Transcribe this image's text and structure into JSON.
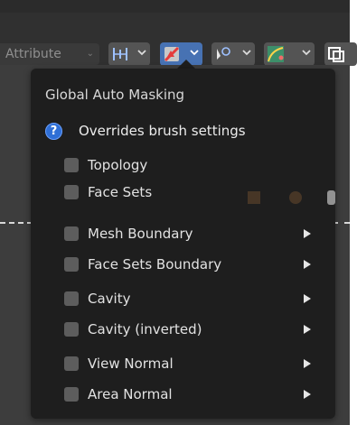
{
  "toolbar": {
    "attribute_label": "Attribute",
    "buttons": [
      {
        "icon": "spacing-icon",
        "active": false
      },
      {
        "icon": "auto-masking-icon",
        "active": true
      },
      {
        "icon": "brush-falloff-icon",
        "active": false
      },
      {
        "icon": "curve-icon",
        "active": false
      },
      {
        "icon": "overlay-icon",
        "active": false
      }
    ]
  },
  "popup": {
    "title": "Global Auto Masking",
    "help_text": "Overrides brush settings",
    "options": [
      {
        "label": "Topology",
        "checked": false,
        "submenu": false
      },
      {
        "label": "Face Sets",
        "checked": false,
        "submenu": false
      },
      {
        "label": "Mesh Boundary",
        "checked": false,
        "submenu": true
      },
      {
        "label": "Face Sets Boundary",
        "checked": false,
        "submenu": true
      },
      {
        "label": "Cavity",
        "checked": false,
        "submenu": true
      },
      {
        "label": "Cavity (inverted)",
        "checked": false,
        "submenu": true
      },
      {
        "label": "View Normal",
        "checked": false,
        "submenu": true
      },
      {
        "label": "Area Normal",
        "checked": false,
        "submenu": true
      }
    ]
  },
  "colors": {
    "accent": "#4772b3",
    "popup_bg": "#1e1e1e",
    "checkbox": "#5d5d5d",
    "help_icon": "#2f6fd6"
  }
}
